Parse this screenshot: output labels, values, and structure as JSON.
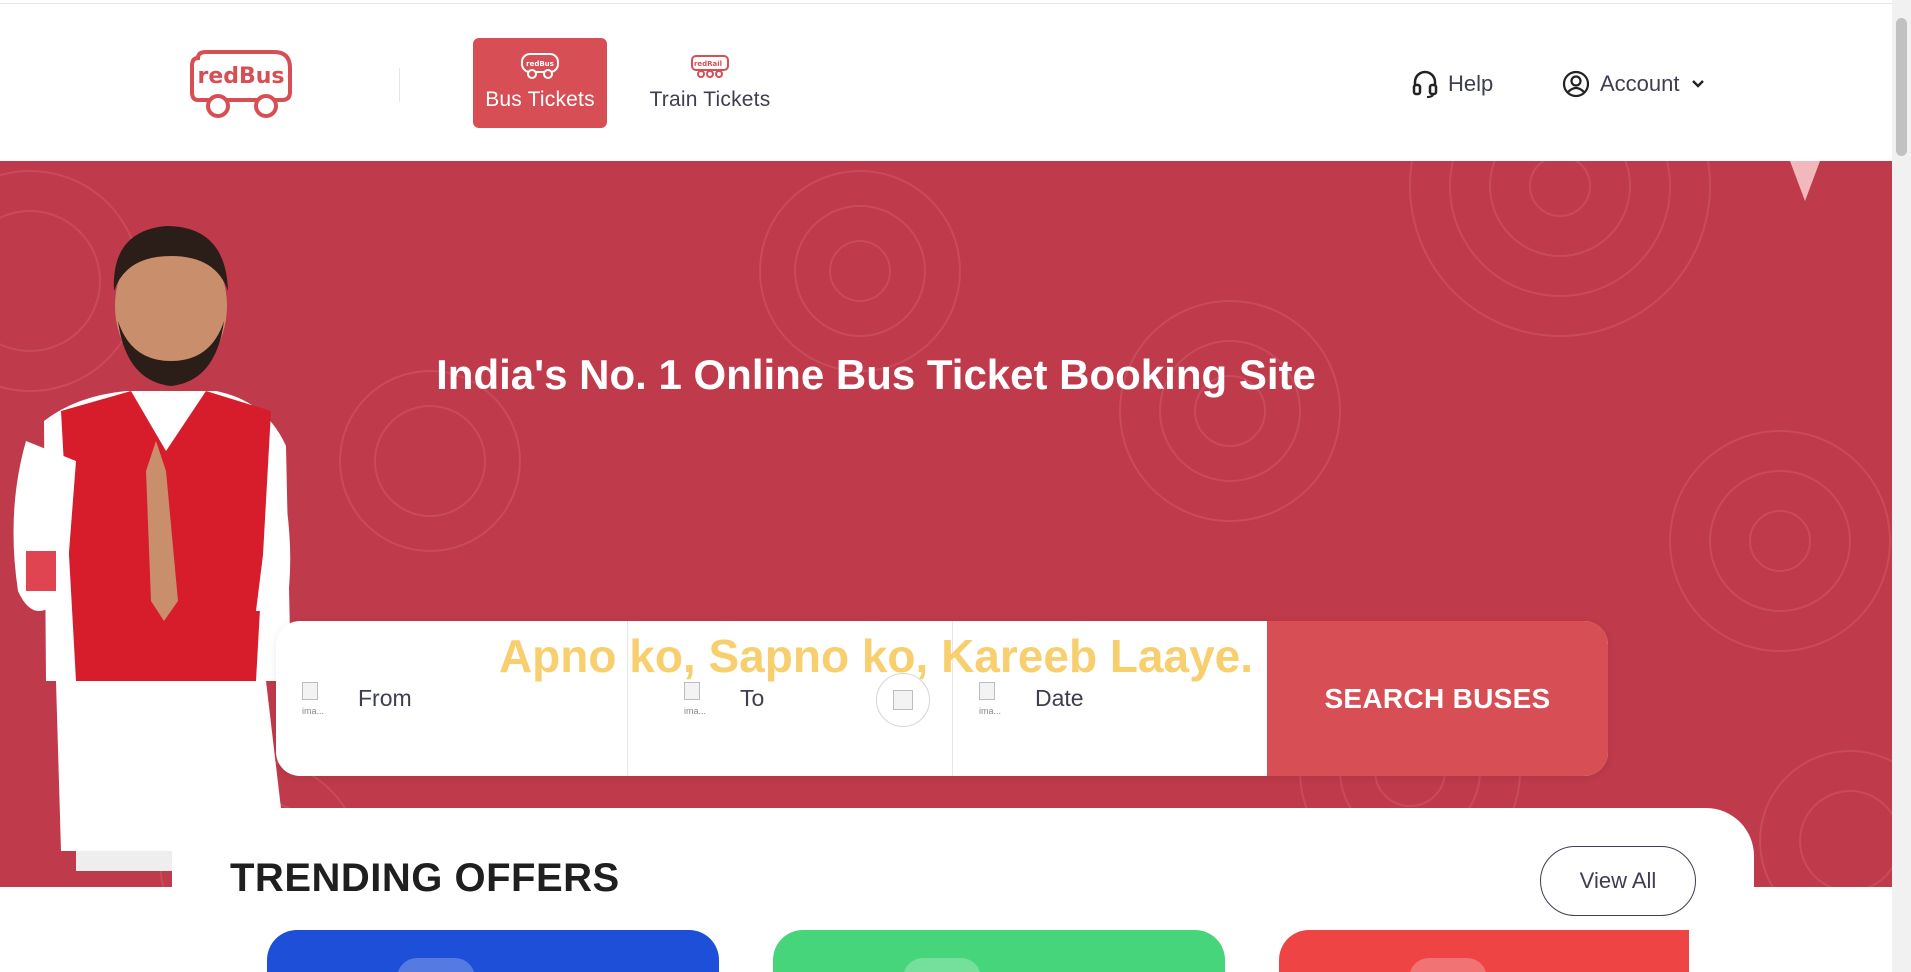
{
  "header": {
    "logo_text": "redBus",
    "tabs": [
      {
        "label": "Bus Tickets",
        "icon": "bus-icon",
        "icon_text": "redBus",
        "active": true
      },
      {
        "label": "Train Tickets",
        "icon": "train-icon",
        "icon_text": "redRail",
        "active": false
      }
    ],
    "help_label": "Help",
    "account_label": "Account"
  },
  "hero": {
    "title": "India's No. 1 Online Bus Ticket Booking Site",
    "tagline": "Apno ko, Sapno ko, Kareeb Laaye.",
    "background_color": "#bf3a4a"
  },
  "search": {
    "from_label": "From",
    "to_label": "To",
    "date_label": "Date",
    "from_img_alt": "ima...",
    "to_img_alt": "ima...",
    "date_img_alt": "ima...",
    "button_label": "SEARCH BUSES"
  },
  "offers": {
    "title": "TRENDING OFFERS",
    "view_all_label": "View All",
    "cards": [
      {
        "color": "#1d4fd8"
      },
      {
        "color": "#47d57b"
      },
      {
        "color": "#ee4444"
      }
    ]
  },
  "colors": {
    "brand": "#d84e55",
    "tagline": "#f7cf6f",
    "text": "#3e3e52"
  }
}
